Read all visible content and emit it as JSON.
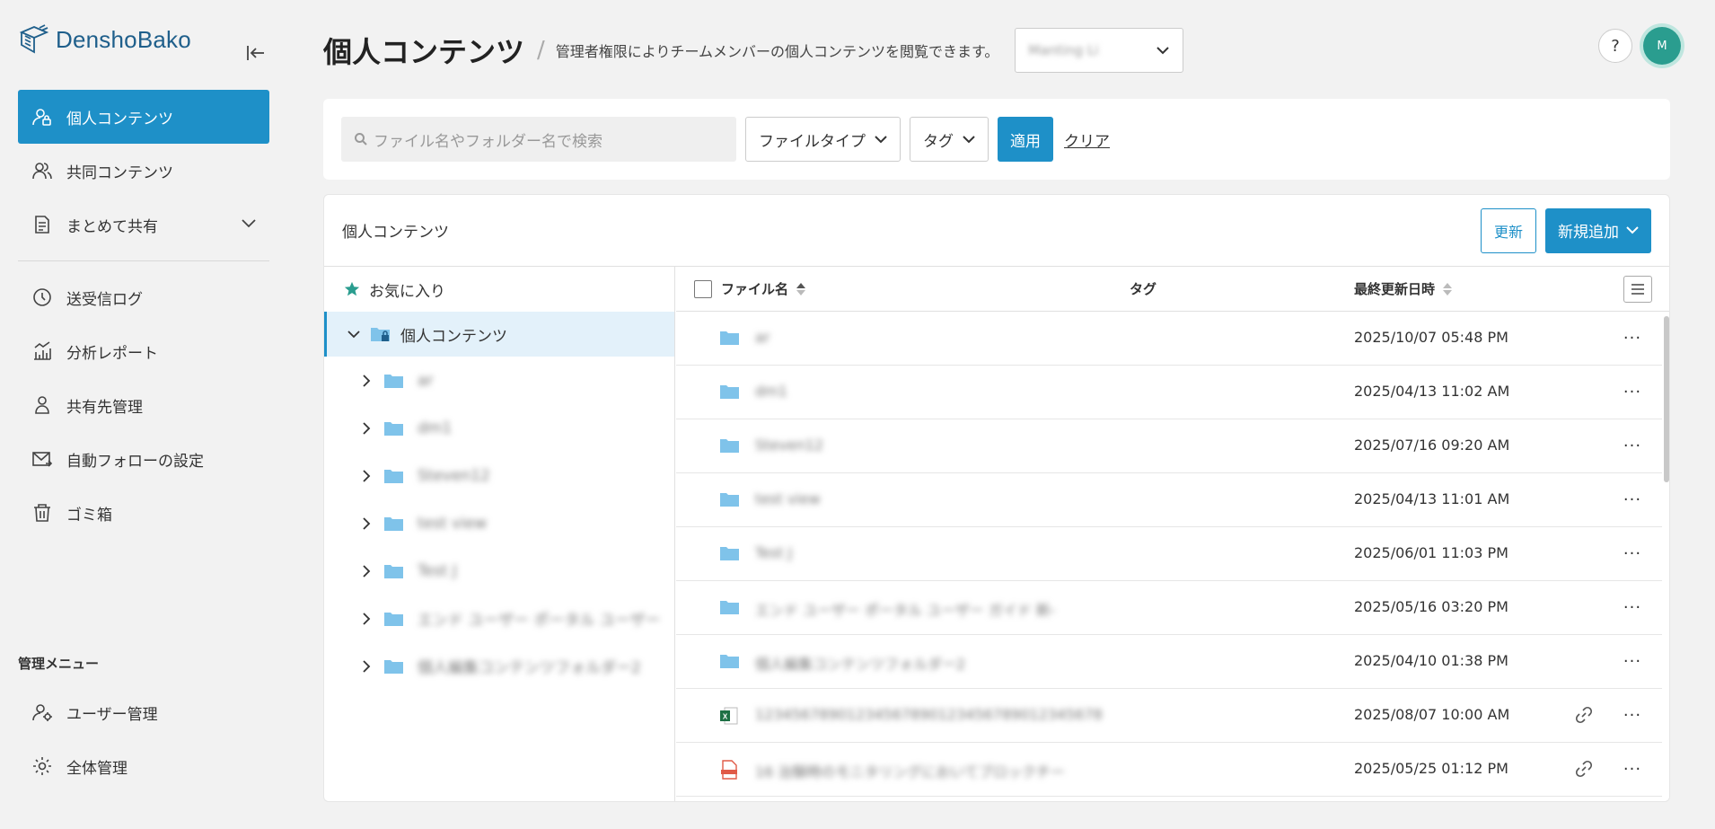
{
  "brand": {
    "name": "DenshoBako",
    "color": "#1f5f8b"
  },
  "accent": "#1e90c8",
  "sidebar": {
    "items": [
      {
        "label": "個人コンテンツ",
        "icon": "user-lock-icon",
        "active": true
      },
      {
        "label": "共同コンテンツ",
        "icon": "users-icon"
      },
      {
        "label": "まとめて共有",
        "icon": "document-share-icon",
        "expandable": true
      },
      {
        "label": "送受信ログ",
        "icon": "clock-history-icon"
      },
      {
        "label": "分析レポート",
        "icon": "bar-chart-icon"
      },
      {
        "label": "共有先管理",
        "icon": "user-settings-icon"
      },
      {
        "label": "自動フォローの設定",
        "icon": "mail-forward-icon"
      },
      {
        "label": "ゴミ箱",
        "icon": "trash-icon"
      }
    ],
    "admin_title": "管理メニュー",
    "admin_items": [
      {
        "label": "ユーザー管理",
        "icon": "user-gear-icon"
      },
      {
        "label": "全体管理",
        "icon": "gear-icon"
      }
    ]
  },
  "header": {
    "title": "個人コンテンツ",
    "separator": "/",
    "description": "管理者権限によりチームメンバーの個人コンテンツを閲覧できます。",
    "member_select_value": "Manting Li",
    "help_label": "?",
    "avatar_initial": "M"
  },
  "search": {
    "placeholder": "ファイル名やフォルダー名で検索",
    "file_type_label": "ファイルタイプ",
    "tag_label": "タグ",
    "apply_label": "適用",
    "clear_label": "クリア"
  },
  "content": {
    "title": "個人コンテンツ",
    "refresh_label": "更新",
    "add_label": "新規追加"
  },
  "tree": {
    "favorites_label": "お気に入り",
    "root_label": "個人コンテンツ",
    "children": [
      "ar",
      "dm1",
      "Steven12",
      "test view",
      "Test J",
      "エンド ユーザー ポータル ユーザー",
      "個人編集コンテンツフォルダー2"
    ]
  },
  "table": {
    "headers": {
      "name": "ファイル名",
      "tag": "タグ",
      "updated": "最終更新日時"
    },
    "rows": [
      {
        "name": "ar",
        "type": "folder",
        "updated": "2025/10/07 05:48 PM",
        "link": false
      },
      {
        "name": "dm1",
        "type": "folder",
        "updated": "2025/04/13 11:02 AM",
        "link": false
      },
      {
        "name": "Steven12",
        "type": "folder",
        "updated": "2025/07/16 09:20 AM",
        "link": false
      },
      {
        "name": "test view",
        "type": "folder",
        "updated": "2025/04/13 11:01 AM",
        "link": false
      },
      {
        "name": "Test J",
        "type": "folder",
        "updated": "2025/06/01 11:03 PM",
        "link": false
      },
      {
        "name": "エンド ユーザー ポータル ユーザー ガイド 新-",
        "type": "folder",
        "updated": "2025/05/16 03:20 PM",
        "link": false
      },
      {
        "name": "個人編集コンテンツフォルダー2",
        "type": "folder",
        "updated": "2025/04/10 01:38 PM",
        "link": false
      },
      {
        "name": "12345678901234567890123456789012345678",
        "type": "excel",
        "updated": "2025/08/07 10:00 AM",
        "link": true
      },
      {
        "name": "16 治験時のモニタリングにおいてブロックチー",
        "type": "pdf",
        "updated": "2025/05/25 01:12 PM",
        "link": true
      }
    ]
  }
}
